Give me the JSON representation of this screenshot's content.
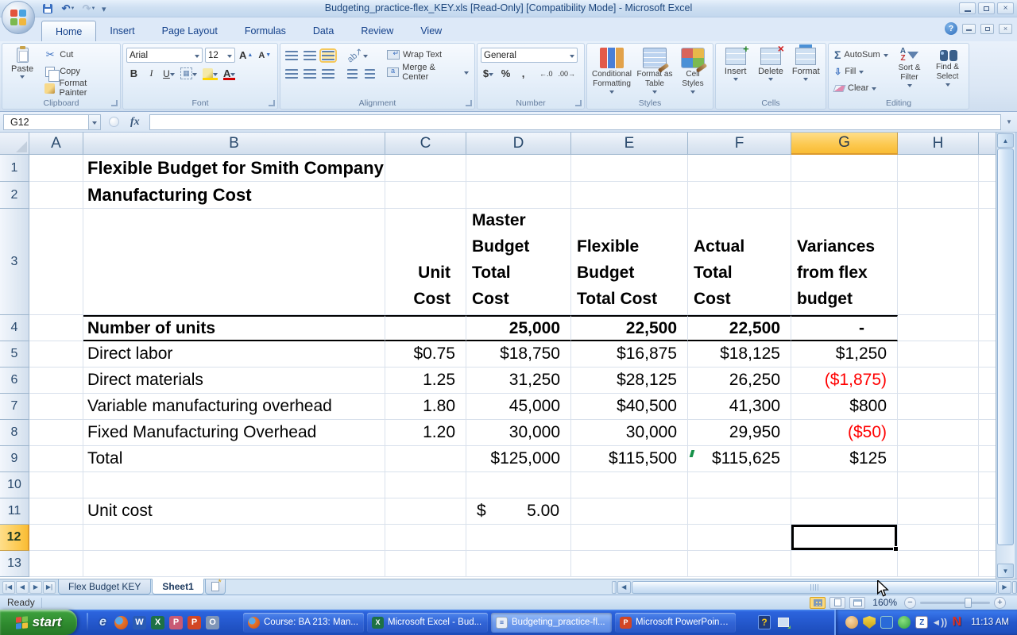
{
  "title_bar": {
    "title": "Budgeting_practice-flex_KEY.xls  [Read-Only]  [Compatibility Mode] - Microsoft Excel"
  },
  "ribbon_tabs": [
    {
      "label": "Home",
      "active": true
    },
    {
      "label": "Insert",
      "active": false
    },
    {
      "label": "Page Layout",
      "active": false
    },
    {
      "label": "Formulas",
      "active": false
    },
    {
      "label": "Data",
      "active": false
    },
    {
      "label": "Review",
      "active": false
    },
    {
      "label": "View",
      "active": false
    }
  ],
  "ribbon": {
    "clipboard": {
      "group": "Clipboard",
      "paste": "Paste",
      "cut": "Cut",
      "copy": "Copy",
      "format_painter": "Format Painter"
    },
    "font": {
      "group": "Font",
      "name": "Arial",
      "size": "12",
      "bold": "B",
      "italic": "I",
      "underline": "U",
      "grow": "A",
      "shrink": "A"
    },
    "alignment": {
      "group": "Alignment",
      "wrap": "Wrap Text",
      "merge": "Merge & Center"
    },
    "number": {
      "group": "Number",
      "format": "General",
      "currency": "$",
      "percent": "%",
      "comma": ",",
      "inc_dec": ".0",
      "dec_dec": ".00"
    },
    "styles": {
      "group": "Styles",
      "conditional": "Conditional Formatting",
      "format_table": "Format as Table",
      "cell_styles": "Cell Styles"
    },
    "cells": {
      "group": "Cells",
      "insert": "Insert",
      "delete": "Delete",
      "format": "Format"
    },
    "editing": {
      "group": "Editing",
      "autosum": "AutoSum",
      "fill": "Fill",
      "clear": "Clear",
      "sort_filter": "Sort & Filter",
      "find_select": "Find & Select"
    }
  },
  "formula_bar": {
    "name_box": "G12",
    "fx": "fx",
    "formula": ""
  },
  "grid": {
    "columns": [
      "A",
      "B",
      "C",
      "D",
      "E",
      "F",
      "G",
      "H"
    ],
    "rows": [
      "1",
      "2",
      "3",
      "4",
      "5",
      "6",
      "7",
      "8",
      "9",
      "10",
      "11",
      "12",
      "13"
    ],
    "active_column": "G",
    "active_row": "12",
    "active_cell": "G12"
  },
  "sheet": {
    "title_line1": "Flexible Budget for Smith Company",
    "title_line2": "Manufacturing Cost",
    "col_headers": {
      "unit_cost": "Unit Cost",
      "master": "Master Budget Total Cost",
      "flex": "Flexible Budget Total Cost",
      "actual": "Actual Total Cost",
      "variance": "Variances from flex budget"
    },
    "rows": [
      {
        "row": 4,
        "label": "Number of units",
        "unit_cost": "",
        "master": "25,000",
        "flex": "22,500",
        "actual": "22,500",
        "variance": "-",
        "bold": true,
        "rule_above": true,
        "rule_below": true
      },
      {
        "row": 5,
        "label": "Direct labor",
        "unit_cost": "$0.75",
        "master": "$18,750",
        "flex": "$16,875",
        "actual": "$18,125",
        "variance": "$1,250"
      },
      {
        "row": 6,
        "label": "Direct materials",
        "unit_cost": "1.25",
        "master": "31,250",
        "flex": "$28,125",
        "actual": "26,250",
        "variance": "($1,875)",
        "variance_negative": true
      },
      {
        "row": 7,
        "label": "Variable manufacturing overhead",
        "unit_cost": "1.80",
        "master": "45,000",
        "flex": "$40,500",
        "actual": "41,300",
        "variance": "$800"
      },
      {
        "row": 8,
        "label": "Fixed Manufacturing Overhead",
        "unit_cost": "1.20",
        "master": "30,000",
        "flex": "30,000",
        "actual": "29,950",
        "variance": "($50)",
        "variance_negative": true
      },
      {
        "row": 9,
        "label": "Total",
        "unit_cost": "",
        "master": "$125,000",
        "flex": "$115,500",
        "actual": "$115,625",
        "variance": "$125",
        "indicator": true
      }
    ],
    "unit_cost_row": {
      "row": 11,
      "label": "Unit cost",
      "currency": "$",
      "value": "5.00"
    }
  },
  "sheet_tabs": [
    {
      "label": "Flex Budget KEY",
      "active": false
    },
    {
      "label": "Sheet1",
      "active": true
    }
  ],
  "status_bar": {
    "status": "Ready",
    "zoom": "160%"
  },
  "taskbar": {
    "start_label": "start",
    "quick_launch": [
      {
        "id": "ie",
        "name": "internet-explorer-icon"
      },
      {
        "id": "firefox",
        "name": "firefox-icon"
      },
      {
        "id": "word",
        "name": "word-icon"
      },
      {
        "id": "excel",
        "name": "excel-icon"
      },
      {
        "id": "publisher",
        "name": "publisher-icon"
      },
      {
        "id": "powerpoint",
        "name": "powerpoint-icon"
      },
      {
        "id": "outlook",
        "name": "outlook-icon"
      }
    ],
    "windows": [
      {
        "label": "Course: BA 213: Man...",
        "icon": "firefox",
        "pressed": false
      },
      {
        "label": "Microsoft Excel - Bud...",
        "icon": "excel",
        "pressed": false
      },
      {
        "label": "Budgeting_practice-fl...",
        "icon": "document",
        "pressed": true
      },
      {
        "label": "Microsoft PowerPoint ...",
        "icon": "powerpoint",
        "pressed": false
      }
    ],
    "tray_icons": [
      {
        "id": "messenger",
        "name": "tray-messenger-icon"
      },
      {
        "id": "shield",
        "name": "tray-security-shield-icon"
      },
      {
        "id": "tool",
        "name": "tray-utility-icon"
      },
      {
        "id": "antivirus",
        "name": "tray-antivirus-icon"
      },
      {
        "id": "zapp",
        "name": "tray-z-app-icon",
        "glyph": "Z"
      },
      {
        "id": "volume",
        "name": "tray-volume-icon"
      },
      {
        "id": "novell",
        "name": "tray-novell-icon",
        "glyph": "N"
      }
    ],
    "clock": "11:13 AM"
  },
  "colors": {
    "negative_value": "#ff0000",
    "selected_header_fill": "#fcc84e",
    "selection_border": "#000000",
    "taskbar_blue": "#2458cd",
    "start_green": "#2f8b2f"
  }
}
